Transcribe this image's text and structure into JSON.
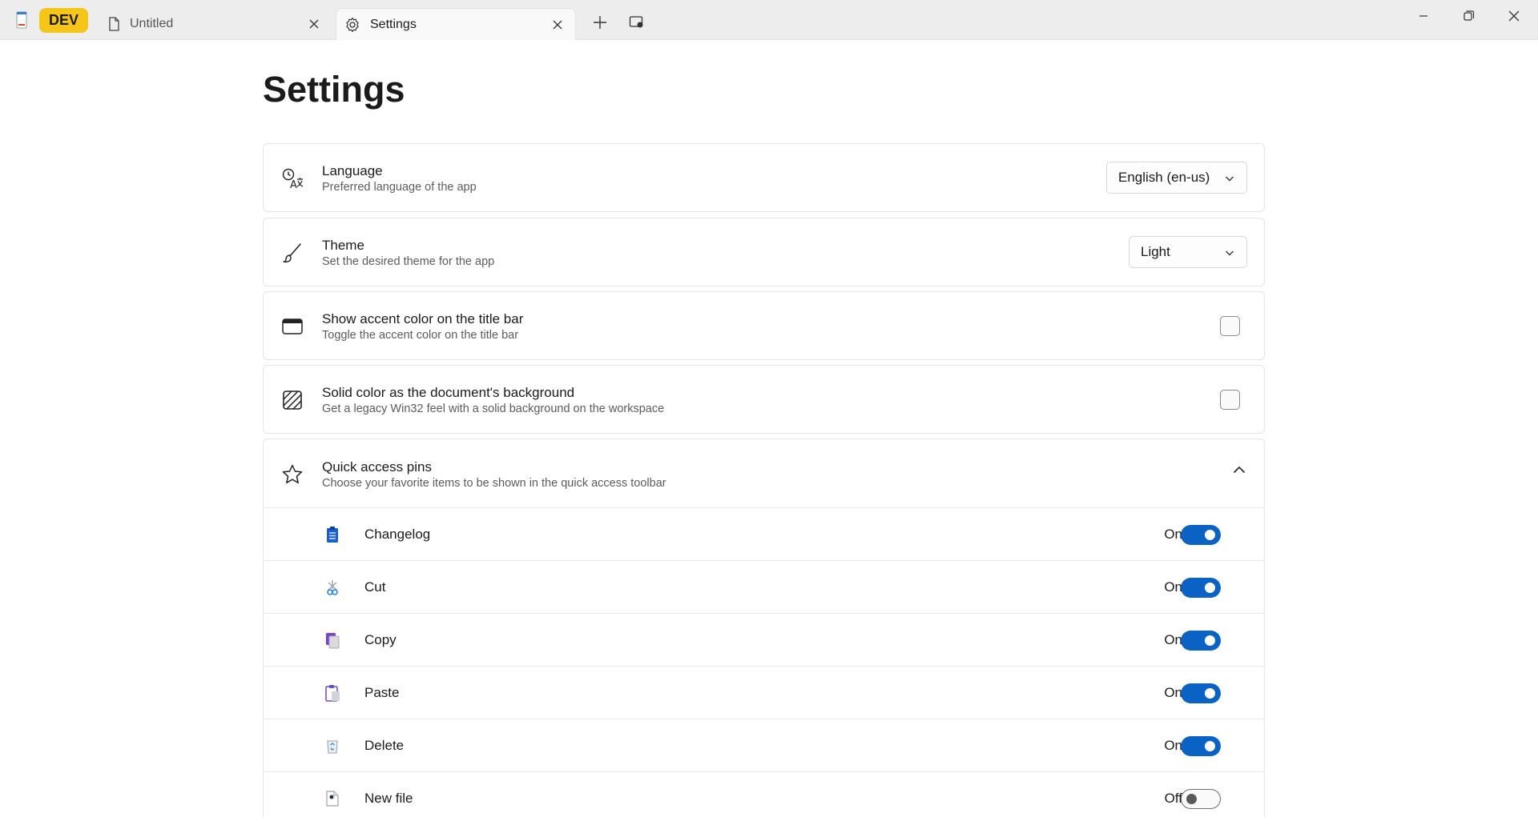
{
  "titlebar": {
    "badge": "DEV",
    "tabs": [
      {
        "label": "Untitled",
        "icon": "document-icon",
        "active": false
      },
      {
        "label": "Settings",
        "icon": "gear-icon",
        "active": true
      }
    ]
  },
  "page": {
    "title": "Settings"
  },
  "settings": {
    "language": {
      "title": "Language",
      "description": "Preferred language of the app",
      "value": "English (en-us)",
      "icon": "language-icon"
    },
    "theme": {
      "title": "Theme",
      "description": "Set the desired theme for the app",
      "value": "Light",
      "icon": "paintbrush-icon"
    },
    "accent": {
      "title": "Show accent color on the title bar",
      "description": "Toggle the accent color on the title bar",
      "checked": false,
      "icon": "window-icon"
    },
    "solid_bg": {
      "title": "Solid color as the document's background",
      "description": "Get a legacy Win32 feel with a solid background on the workspace",
      "checked": false,
      "icon": "hatched-square-icon"
    },
    "quick_access": {
      "title": "Quick access pins",
      "description": "Choose your favorite items to be shown in the quick access toolbar",
      "icon": "star-icon",
      "expanded": true,
      "pins": [
        {
          "label": "Changelog",
          "state": "On",
          "on": true,
          "icon": "clipboard-list-icon"
        },
        {
          "label": "Cut",
          "state": "On",
          "on": true,
          "icon": "scissors-icon"
        },
        {
          "label": "Copy",
          "state": "On",
          "on": true,
          "icon": "copy-icon"
        },
        {
          "label": "Paste",
          "state": "On",
          "on": true,
          "icon": "paste-icon"
        },
        {
          "label": "Delete",
          "state": "On",
          "on": true,
          "icon": "recycle-bin-icon"
        },
        {
          "label": "New file",
          "state": "Off",
          "on": false,
          "icon": "new-file-icon"
        }
      ]
    }
  },
  "colors": {
    "accent": "#0a63c4",
    "badge": "#f5c518"
  }
}
